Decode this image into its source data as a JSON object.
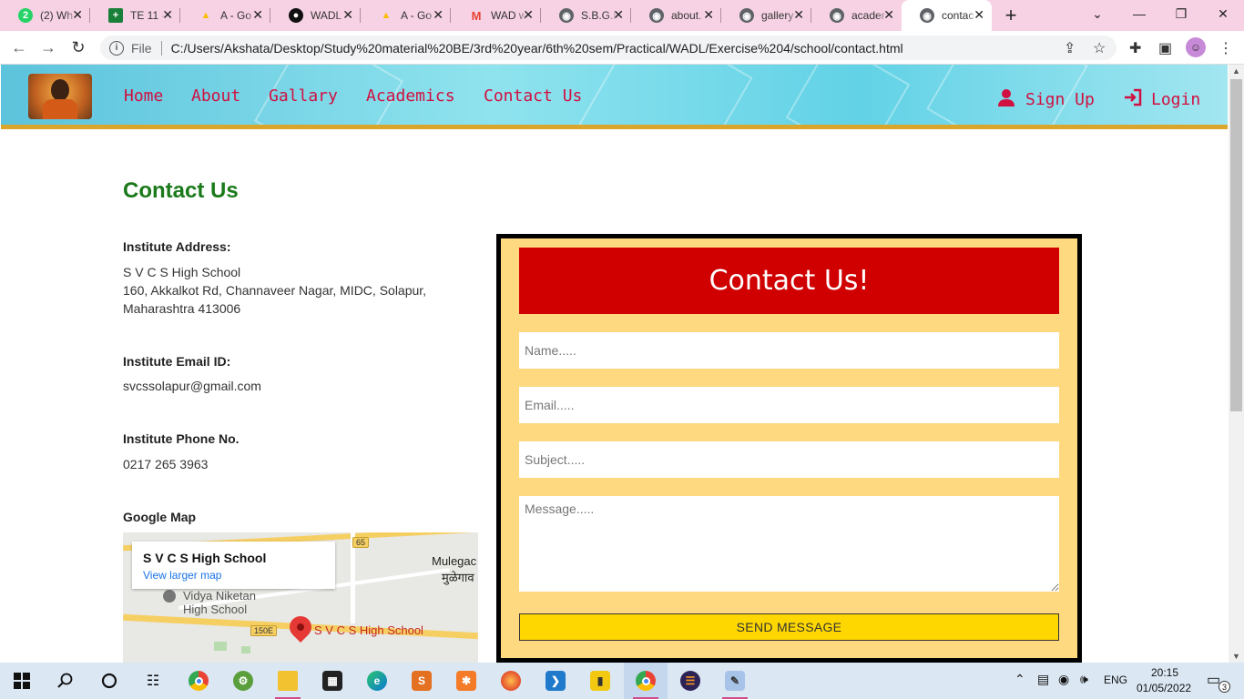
{
  "browser": {
    "tabs": [
      {
        "title": "(2) Wh",
        "icon": "whatsapp-icon",
        "badge": "2",
        "color": "#25d366"
      },
      {
        "title": "TE 11 -",
        "icon": "sheets-icon",
        "color": "#188038"
      },
      {
        "title": "A - Go",
        "icon": "drive-icon",
        "color": "#fbbc04"
      },
      {
        "title": "WADL",
        "icon": "github-icon",
        "color": "#111111"
      },
      {
        "title": "A - Go",
        "icon": "drive-icon",
        "color": "#fbbc04"
      },
      {
        "title": "WAD w",
        "icon": "gmail-icon",
        "color": "#ea4335"
      },
      {
        "title": "S.B.G.P",
        "icon": "globe-icon",
        "color": "#5f6368"
      },
      {
        "title": "about.",
        "icon": "globe-icon",
        "color": "#5f6368"
      },
      {
        "title": "gallery",
        "icon": "globe-icon",
        "color": "#5f6368"
      },
      {
        "title": "acader",
        "icon": "globe-icon",
        "color": "#5f6368"
      },
      {
        "title": "contac",
        "icon": "globe-icon",
        "color": "#5f6368",
        "active": true
      }
    ],
    "file_label": "File",
    "url": "C:/Users/Akshata/Desktop/Study%20material%20BE/3rd%20year/6th%20sem/Practical/WADL/Exercise%204/school/contact.html"
  },
  "site": {
    "nav": [
      "Home",
      "About",
      "Gallary",
      "Academics",
      "Contact Us"
    ],
    "signup": "Sign Up",
    "login": "Login"
  },
  "contact": {
    "title": "Contact Us",
    "address_label": "Institute Address:",
    "address_lines": [
      "S V C S High School",
      "160, Akkalkot Rd, Channaveer Nagar, MIDC, Solapur,",
      "Maharashtra 413006"
    ],
    "email_label": "Institute Email ID:",
    "email": "svcssolapur@gmail.com",
    "phone_label": "Institute Phone No.",
    "phone": "0217 265 3963",
    "map_label": "Google Map",
    "map": {
      "place_name": "S V C S High School",
      "larger_map": "View larger map",
      "labels": [
        "Mulegac",
        "मुळेगाव",
        "Vidya Niketan",
        "High School",
        "S V C S High School",
        "150E",
        "65"
      ]
    }
  },
  "form": {
    "heading": "Contact Us!",
    "name_placeholder": "Name.....",
    "email_placeholder": "Email.....",
    "subject_placeholder": "Subject.....",
    "message_placeholder": "Message.....",
    "submit_label": "SEND MESSAGE"
  },
  "taskbar": {
    "language": "ENG",
    "time": "20:15",
    "date": "01/05/2022",
    "notifications": "3"
  }
}
